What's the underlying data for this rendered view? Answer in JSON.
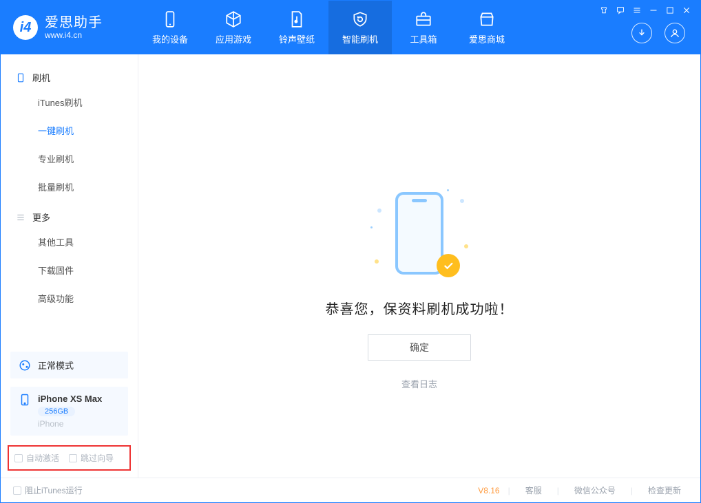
{
  "logo": {
    "cn": "爱思助手",
    "en": "www.i4.cn"
  },
  "tabs": [
    {
      "label": "我的设备"
    },
    {
      "label": "应用游戏"
    },
    {
      "label": "铃声壁纸"
    },
    {
      "label": "智能刷机"
    },
    {
      "label": "工具箱"
    },
    {
      "label": "爱思商城"
    }
  ],
  "sidebar": {
    "sec1_title": "刷机",
    "items1": [
      {
        "label": "iTunes刷机"
      },
      {
        "label": "一键刷机"
      },
      {
        "label": "专业刷机"
      },
      {
        "label": "批量刷机"
      }
    ],
    "sec2_title": "更多",
    "items2": [
      {
        "label": "其他工具"
      },
      {
        "label": "下载固件"
      },
      {
        "label": "高级功能"
      }
    ]
  },
  "mode": {
    "label": "正常模式"
  },
  "device": {
    "name": "iPhone XS Max",
    "storage": "256GB",
    "type": "iPhone"
  },
  "opts": {
    "auto_activate": "自动激活",
    "skip_guide": "跳过向导"
  },
  "hero": {
    "title": "恭喜您，保资料刷机成功啦！",
    "ok": "确定",
    "log": "查看日志"
  },
  "status": {
    "block_itunes": "阻止iTunes运行",
    "version": "V8.16",
    "links": [
      "客服",
      "微信公众号",
      "检查更新"
    ]
  }
}
